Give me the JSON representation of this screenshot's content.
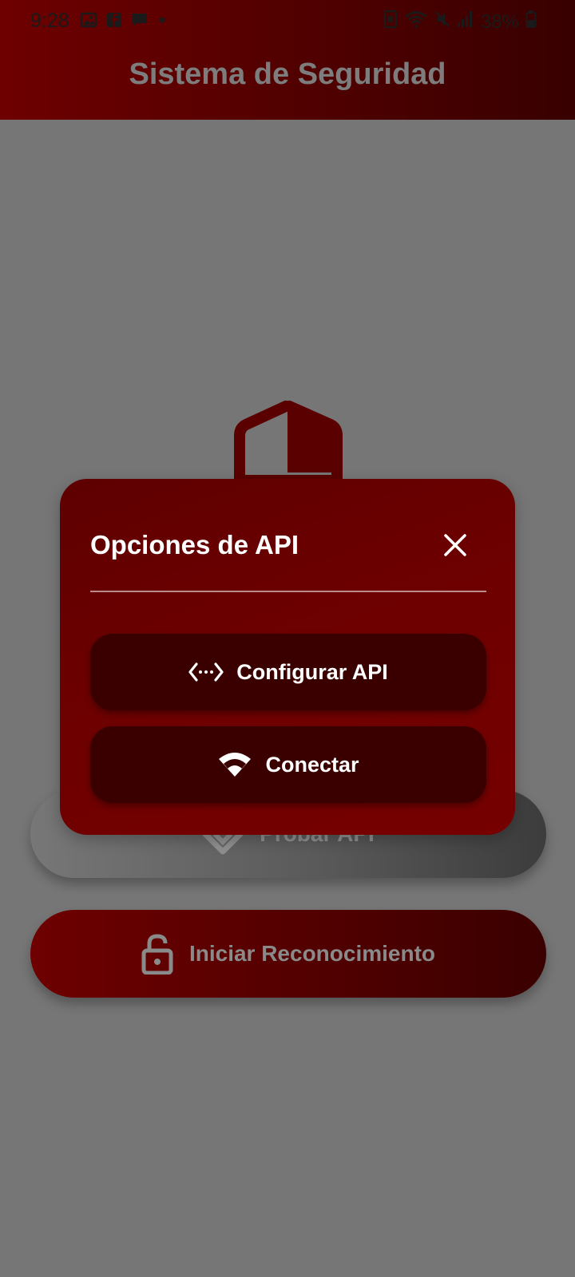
{
  "status_bar": {
    "time": "9:28",
    "battery_percent": "38%",
    "left_icons": [
      "image-icon",
      "facebook-icon",
      "message-icon",
      "dot-icon"
    ],
    "right_icons": [
      "nfc-icon",
      "wifi-icon",
      "mute-icon",
      "signal-icon",
      "battery-icon"
    ]
  },
  "app_bar": {
    "title": "Sistema de Seguridad"
  },
  "main": {
    "logo_icon": "shield-icon",
    "buttons": {
      "probar_api": "Probar API",
      "iniciar_reconocimiento": "Iniciar Reconocimiento"
    }
  },
  "dialog": {
    "title": "Opciones de API",
    "close_icon": "close-icon",
    "options": {
      "configurar": "Configurar API",
      "conectar": "Conectar"
    }
  },
  "colors": {
    "primary": "#6e0000",
    "dark_red": "#3a0000",
    "scrim": "#767676",
    "white": "#ffffff"
  }
}
